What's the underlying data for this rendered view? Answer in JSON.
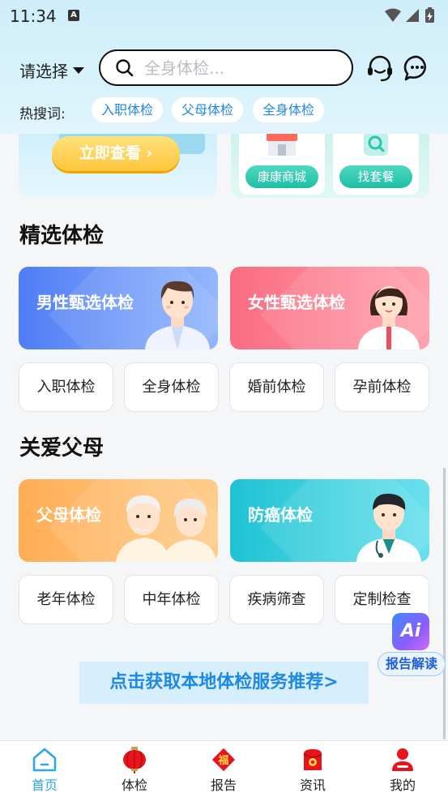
{
  "status_bar": {
    "time": "11:34",
    "notification_icon": "A"
  },
  "header": {
    "location_label": "请选择",
    "search": {
      "placeholder": "全身体检..."
    },
    "hot_label": "热搜词:",
    "hot_tags": [
      "入职体检",
      "父母体检",
      "全身体检"
    ],
    "icons": [
      "headset-icon",
      "chat-icon"
    ]
  },
  "promo": {
    "view_now": "立即查看 ›",
    "cards": [
      "康康商城",
      "找套餐"
    ]
  },
  "selected_section": {
    "title": "精选体检",
    "feature_cards": [
      "男性甄选体检",
      "女性甄选体检"
    ],
    "buttons": [
      "入职体检",
      "全身体检",
      "婚前体检",
      "孕前体检"
    ]
  },
  "parents_section": {
    "title": "关爱父母",
    "feature_cards": [
      "父母体检",
      "防癌体检"
    ],
    "buttons": [
      "老年体检",
      "中年体检",
      "疾病筛查",
      "定制检查"
    ]
  },
  "cta": "点击获取本地体检服务推荐>",
  "ai_float": {
    "badge": "Ai",
    "label": "报告解读"
  },
  "tabbar": {
    "active": "首页",
    "tabs": [
      "首页",
      "体检",
      "报告",
      "资讯",
      "我的"
    ],
    "report_icon_char": "福"
  },
  "colors": {
    "accent_blue": "#1e88e5",
    "tab_active": "#2aa7f0",
    "male_card": "#4f7df6",
    "female_card": "#fa6c81",
    "parents_card": "#ffad55",
    "cancer_card": "#1ec3d3",
    "tab_red": "#e8141b"
  }
}
